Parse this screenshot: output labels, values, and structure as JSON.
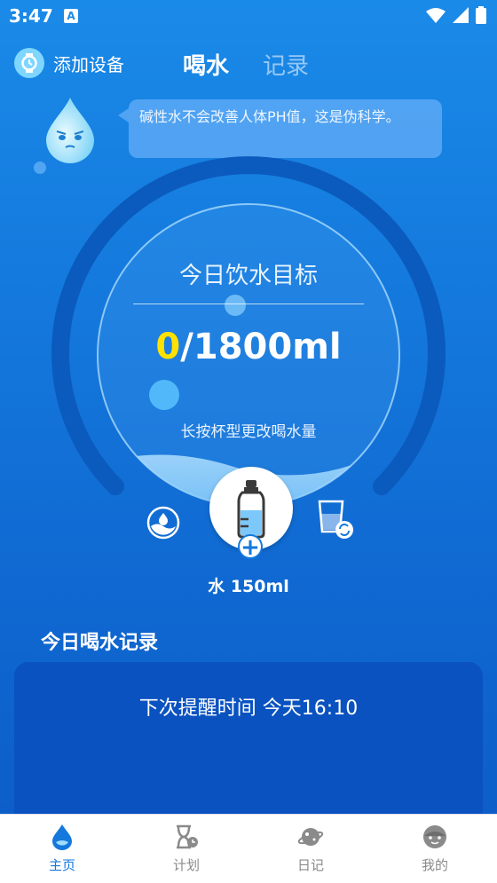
{
  "status": {
    "time": "3:47",
    "notif_badge": "A"
  },
  "header": {
    "add_device_label": "添加设备",
    "tabs": [
      {
        "label": "喝水",
        "active": true
      },
      {
        "label": "记录",
        "active": false
      }
    ]
  },
  "tip": {
    "text": "碱性水不会改善人体PH值，这是伪科学。"
  },
  "goal": {
    "title": "今日饮水目标",
    "current": "0",
    "target": "/1800ml",
    "hint": "长按杯型更改喝水量"
  },
  "drink": {
    "label": "水 150ml"
  },
  "record": {
    "section_title": "今日喝水记录",
    "next_reminder": "下次提醒时间 今天16:10"
  },
  "nav": [
    {
      "label": "主页",
      "icon": "drop-icon",
      "active": true
    },
    {
      "label": "计划",
      "icon": "hourglass-clock-icon",
      "active": false
    },
    {
      "label": "日记",
      "icon": "planet-icon",
      "active": false
    },
    {
      "label": "我的",
      "icon": "face-icon",
      "active": false
    }
  ],
  "colors": {
    "accent": "#1478dc",
    "highlight": "#ffe100"
  }
}
